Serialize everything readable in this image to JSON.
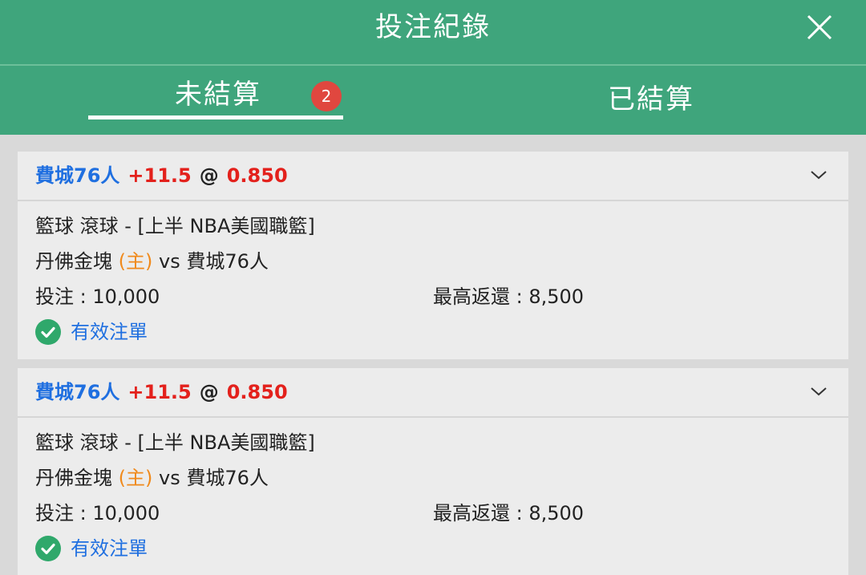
{
  "header": {
    "title": "投注紀錄"
  },
  "tabs": {
    "pending": {
      "label": "未結算",
      "badge": "2"
    },
    "settled": {
      "label": "已結算"
    }
  },
  "bets": [
    {
      "team": "費城76人",
      "line": "+11.5",
      "at": "@",
      "odds": "0.850",
      "league": "籃球 滾球 - [上半 NBA美國職籃]",
      "home_team": "丹佛金塊",
      "home_tag": "(主)",
      "vs": "vs",
      "away_team": "費城76人",
      "stake": "投注 : 10,000",
      "max_return": "最高返還 : 8,500",
      "status": "有效注單"
    },
    {
      "team": "費城76人",
      "line": "+11.5",
      "at": "@",
      "odds": "0.850",
      "league": "籃球 滾球 - [上半 NBA美國職籃]",
      "home_team": "丹佛金塊",
      "home_tag": "(主)",
      "vs": "vs",
      "away_team": "費城76人",
      "stake": "投注 : 10,000",
      "max_return": "最高返還 : 8,500",
      "status": "有效注單"
    }
  ],
  "colors": {
    "brand_green": "#3fa57c",
    "team_blue": "#1f6fe0",
    "odds_red": "#e3211c",
    "home_orange": "#f08a1c",
    "badge_red": "#e0473f"
  },
  "icons": {
    "close": "close-icon",
    "expand": "chevron-down-icon",
    "status": "check-circle-icon"
  }
}
